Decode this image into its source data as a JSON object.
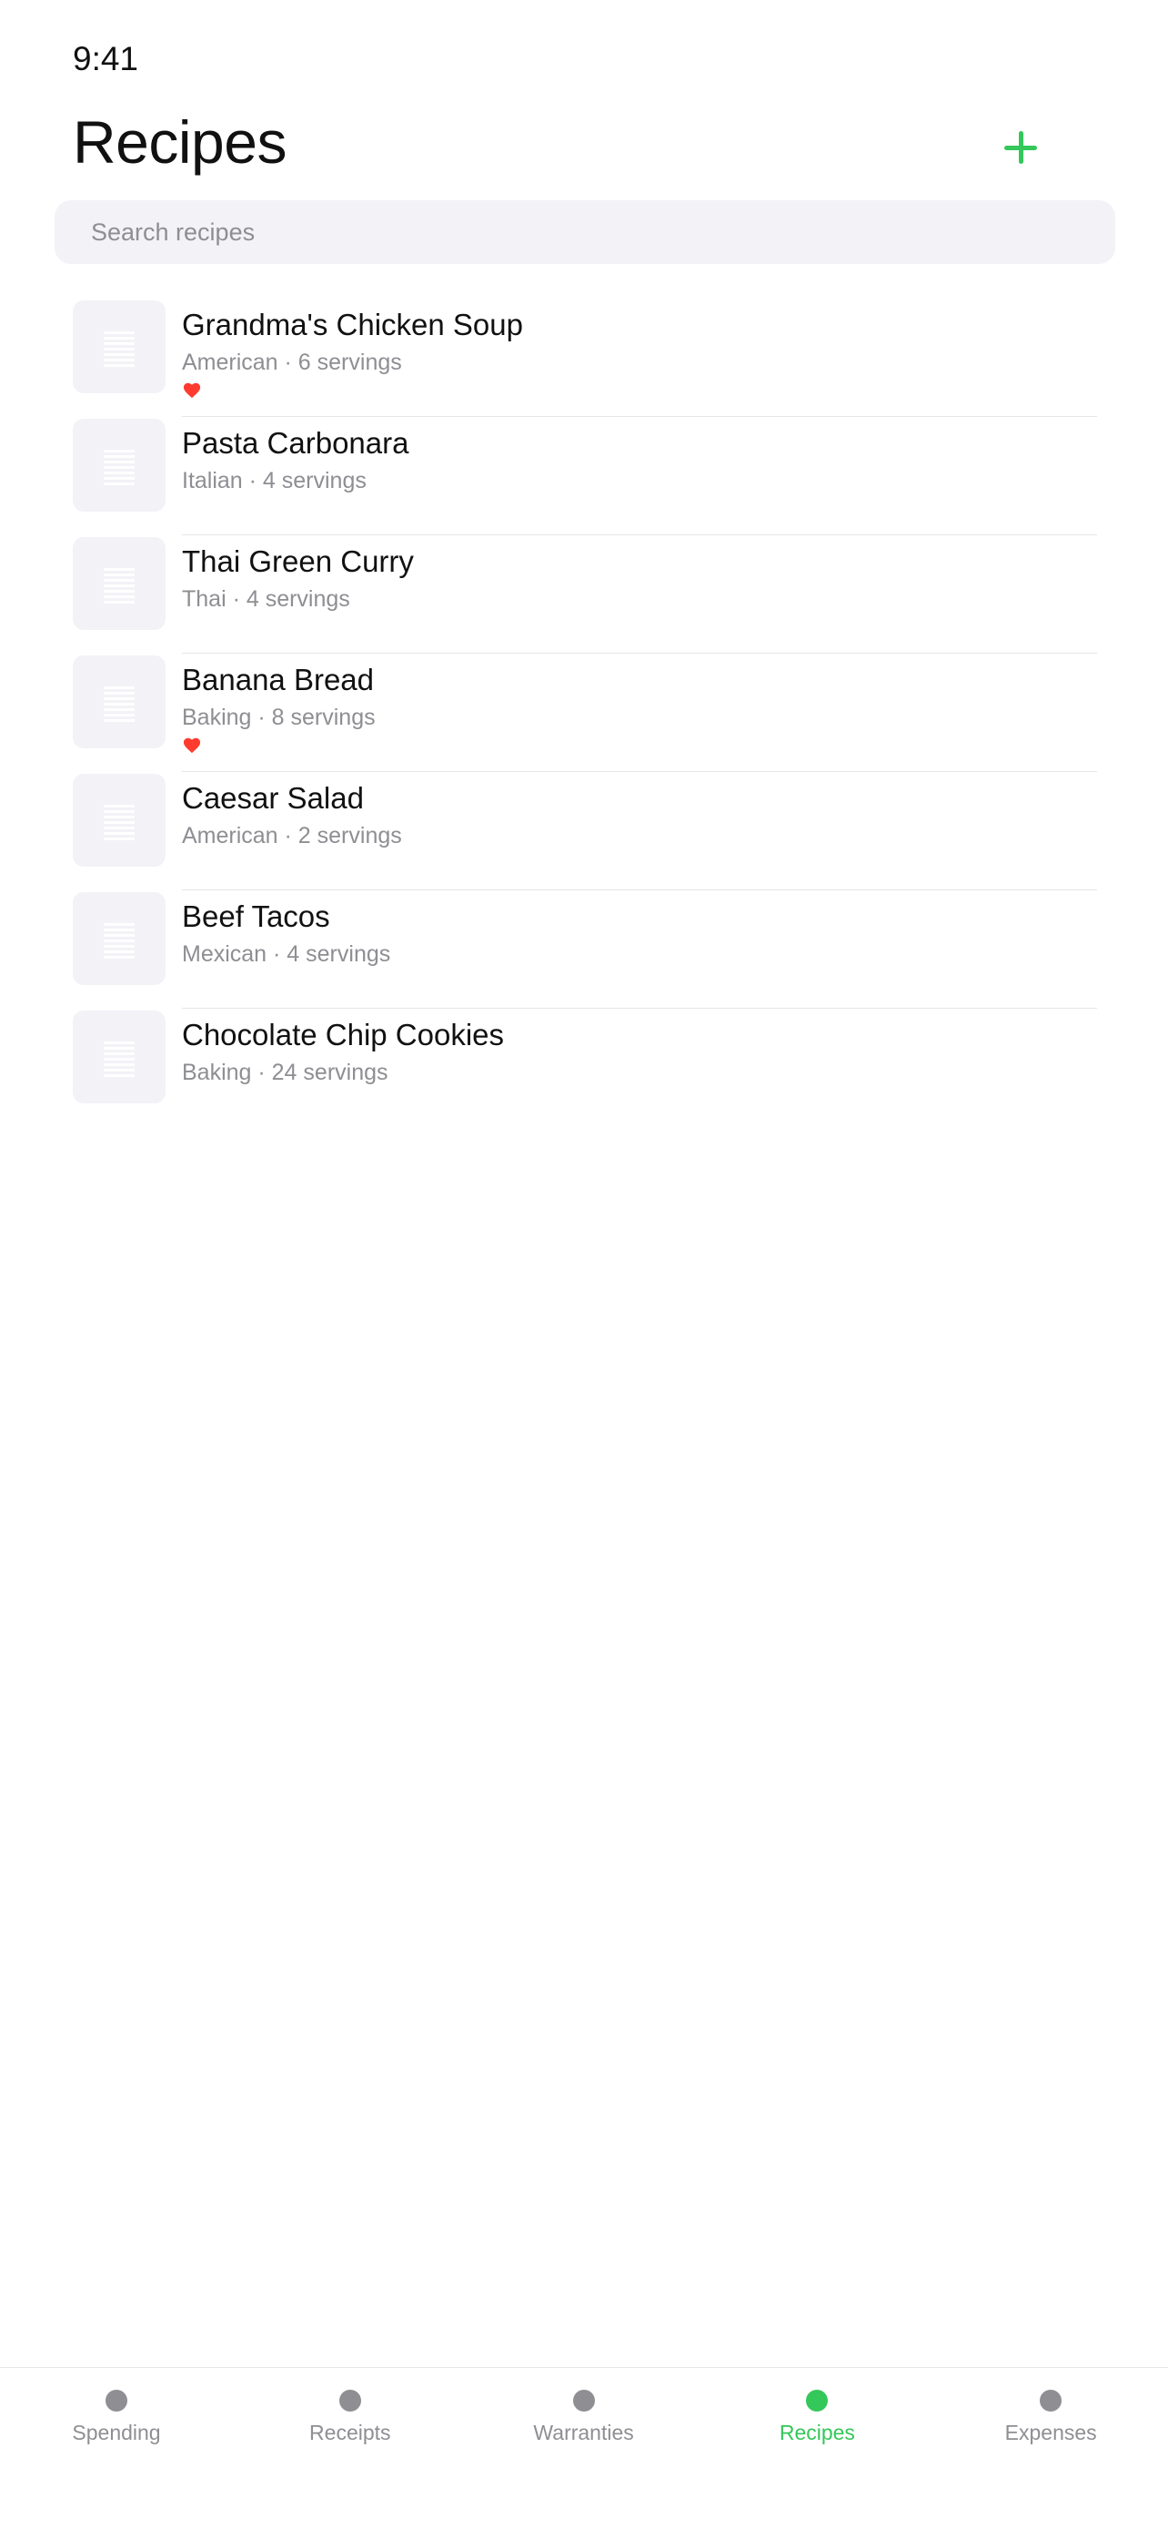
{
  "status_bar": {
    "time": "9:41"
  },
  "header": {
    "title": "Recipes",
    "add_icon": "plus-icon"
  },
  "search": {
    "placeholder": "Search recipes",
    "value": ""
  },
  "recipes": [
    {
      "name": "Grandma's Chicken Soup",
      "subtitle": "American · 6 servings",
      "favorite": true
    },
    {
      "name": "Pasta Carbonara",
      "subtitle": "Italian · 4 servings",
      "favorite": false
    },
    {
      "name": "Thai Green Curry",
      "subtitle": "Thai · 4 servings",
      "favorite": false
    },
    {
      "name": "Banana Bread",
      "subtitle": "Baking · 8 servings",
      "favorite": true
    },
    {
      "name": "Caesar Salad",
      "subtitle": "American · 2 servings",
      "favorite": false
    },
    {
      "name": "Beef Tacos",
      "subtitle": "Mexican · 4 servings",
      "favorite": false
    },
    {
      "name": "Chocolate Chip Cookies",
      "subtitle": "Baking · 24 servings",
      "favorite": false
    }
  ],
  "tabs": [
    {
      "label": "Spending",
      "active": false
    },
    {
      "label": "Receipts",
      "active": false
    },
    {
      "label": "Warranties",
      "active": false
    },
    {
      "label": "Recipes",
      "active": true
    },
    {
      "label": "Expenses",
      "active": false
    }
  ],
  "colors": {
    "accent": "#34c759",
    "secondary_text": "#8e8e93",
    "favorite": "#ff3b30",
    "thumb_bg": "#f2f2f7"
  },
  "icons": {
    "thumbnail": "recipe-thumbnail-icon",
    "favorite": "heart-icon",
    "tab": "tab-dot-icon"
  }
}
